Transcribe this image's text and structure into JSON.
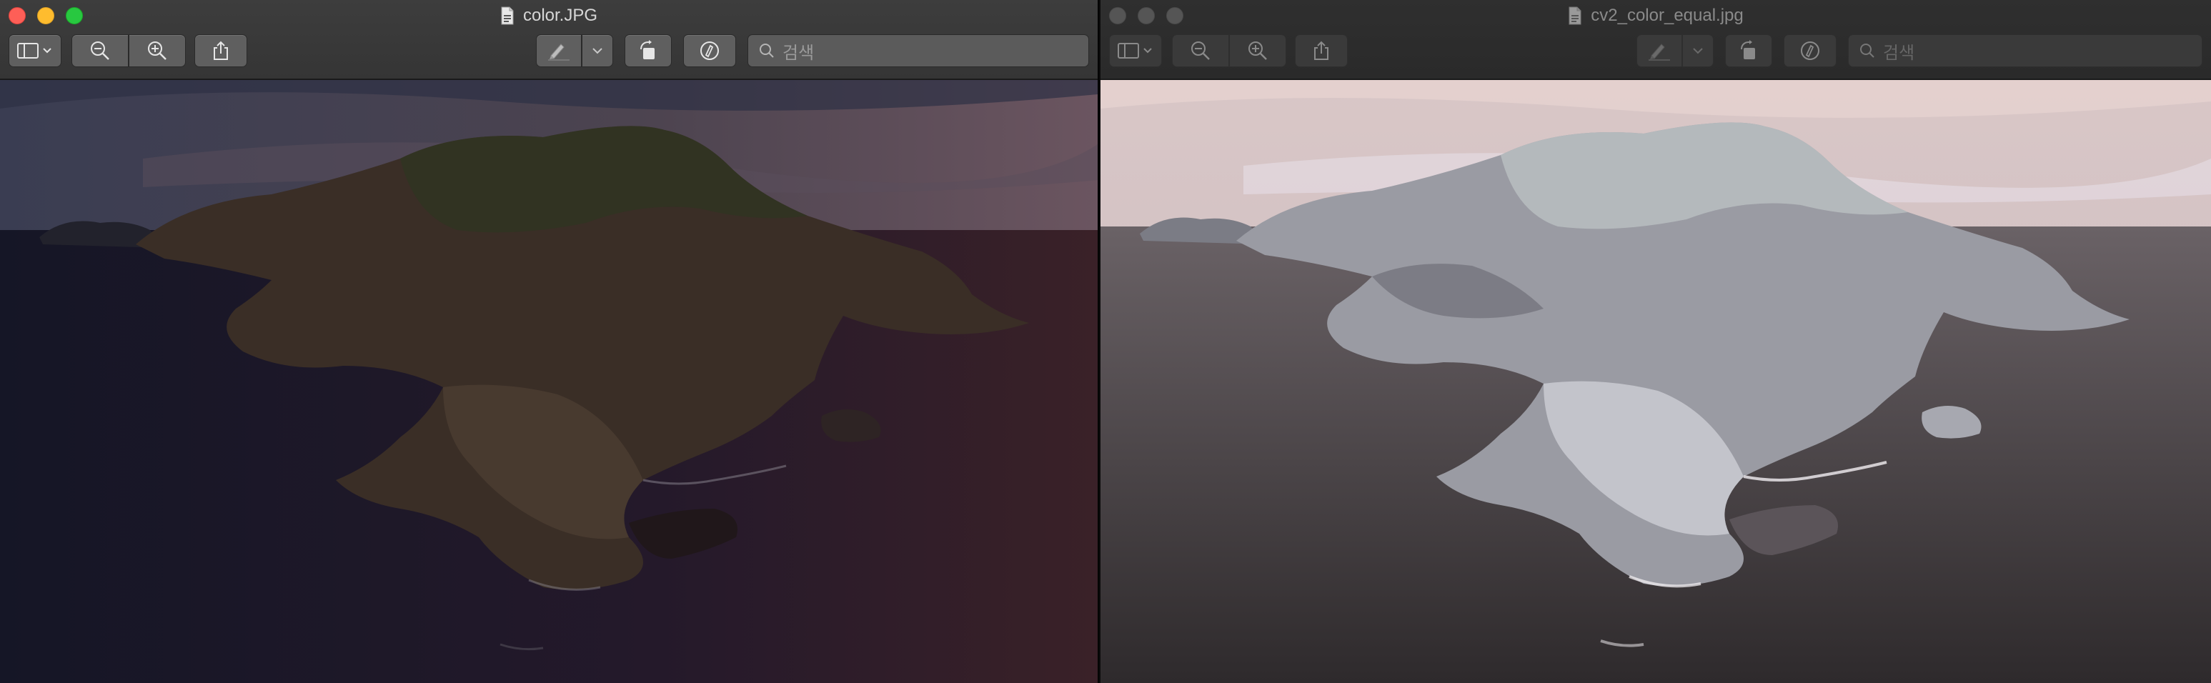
{
  "windows": {
    "left": {
      "title": "color.JPG",
      "active": true,
      "search_placeholder": "검색",
      "image_alt": "color.JPG"
    },
    "right": {
      "title": "cv2_color_equal.jpg",
      "active": false,
      "search_placeholder": "검색",
      "image_alt": "cv2_color_equal.jpg"
    }
  },
  "toolbar_icons": [
    "sidebar-toggle-icon",
    "zoom-out-icon",
    "zoom-in-icon",
    "share-icon",
    "markup-pen-icon",
    "rotate-icon",
    "annotate-icon",
    "search-icon"
  ],
  "colors": {
    "close": "#fe5f57",
    "minimize": "#febc2e",
    "zoom": "#28c840",
    "toolbar": "#3d3d3d"
  }
}
